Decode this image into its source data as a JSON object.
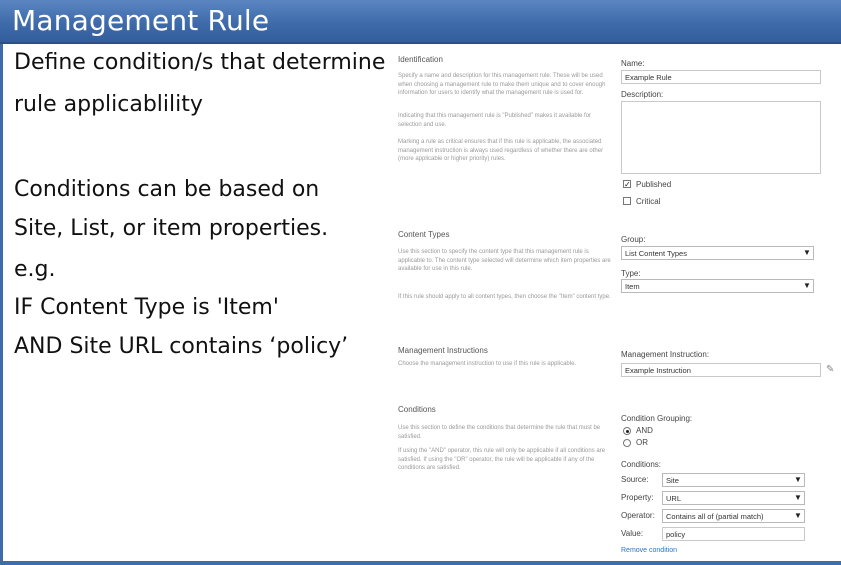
{
  "slide": {
    "title": "Management Rule",
    "bullets": [
      "Define condition/s that determine",
      "rule applicablility",
      "Conditions can be based on",
      "Site, List, or item properties.",
      "e.g.",
      "IF Content Type is 'Item'",
      "AND Site URL contains ‘policy’"
    ]
  },
  "form": {
    "identification": {
      "title": "Identification",
      "desc1": "Specify a name and description for this management rule. These will be used when choosing a management rule to make them unique and to cover enough information for users to identify what the management rule is used for.",
      "desc2": "Indicating that this management rule is \"Published\" makes it available for selection and use.",
      "desc3": "Marking a rule as critical ensures that if this rule is applicable, the associated management instruction is always used regardless of whether there are other (more applicable or higher priority) rules.",
      "name_label": "Name:",
      "name_value": "Example Rule",
      "description_label": "Description:",
      "published_label": "Published",
      "critical_label": "Critical"
    },
    "content_types": {
      "title": "Content Types",
      "desc1": "Use this section to specify the content type that this management rule is applicable to. The content type selected will determine which item properties are available for use in this rule.",
      "desc2": "If this rule should apply to all content types, then choose the \"Item\" content type.",
      "group_label": "Group:",
      "group_value": "List Content Types",
      "type_label": "Type:",
      "type_value": "Item"
    },
    "management_instructions": {
      "title": "Management Instructions",
      "desc": "Choose the management instruction to use if this rule is applicable.",
      "label": "Management Instruction:",
      "value": "Example Instruction"
    },
    "conditions": {
      "title": "Conditions",
      "desc1": "Use this section to define the conditions that determine the rule that must be satisfied.",
      "desc2": "If using the \"AND\" operator, this rule will only be applicable if all conditions are satisfied. If using the \"OR\" operator, the rule will be applicable if any of the conditions are satisfied.",
      "grouping_label": "Condition Grouping:",
      "and_label": "AND",
      "or_label": "OR",
      "conditions_label": "Conditions:",
      "source_label": "Source:",
      "source_value": "Site",
      "property_label": "Property:",
      "property_value": "URL",
      "operator_label": "Operator:",
      "operator_value": "Contains all of (partial match)",
      "value_label": "Value:",
      "value_value": "policy",
      "remove_link": "Remove condition"
    }
  },
  "glyphs": {
    "dropdown": "▼",
    "check": "✓",
    "browse": "✎"
  }
}
